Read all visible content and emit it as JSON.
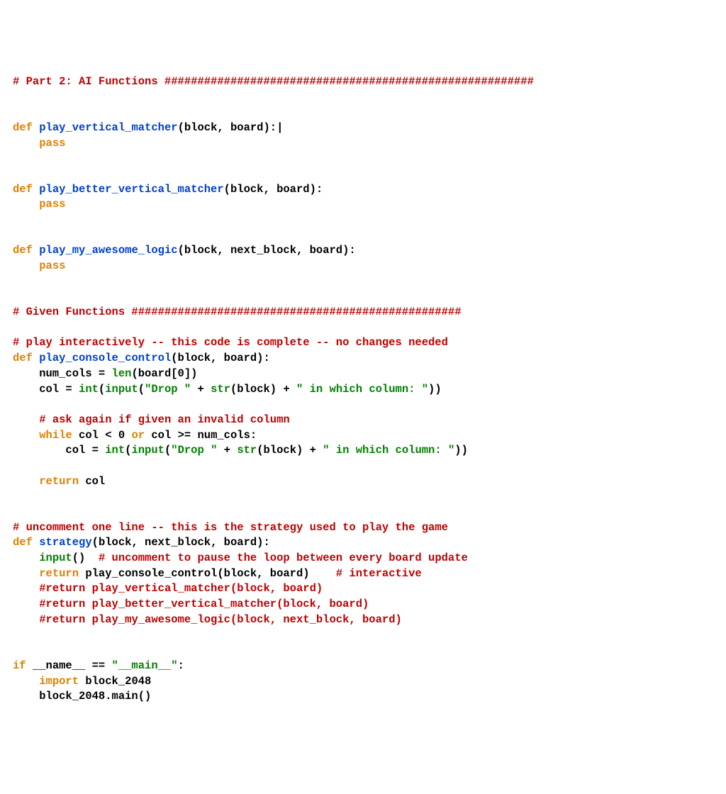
{
  "code": {
    "lines": [
      {
        "tokens": [
          {
            "cls": "t-comment",
            "t": "# Part 2: AI Functions ########################################################"
          }
        ]
      },
      {
        "tokens": []
      },
      {
        "tokens": []
      },
      {
        "tokens": [
          {
            "cls": "t-keyword",
            "t": "def"
          },
          {
            "cls": "t-default",
            "t": " "
          },
          {
            "cls": "t-funcname",
            "t": "play_vertical_matcher"
          },
          {
            "cls": "t-default",
            "t": "(block, board):"
          },
          {
            "cls": "t-cursor",
            "t": "|"
          }
        ]
      },
      {
        "tokens": [
          {
            "cls": "t-default",
            "t": "    "
          },
          {
            "cls": "t-keyword",
            "t": "pass"
          }
        ]
      },
      {
        "tokens": []
      },
      {
        "tokens": []
      },
      {
        "tokens": [
          {
            "cls": "t-keyword",
            "t": "def"
          },
          {
            "cls": "t-default",
            "t": " "
          },
          {
            "cls": "t-funcname",
            "t": "play_better_vertical_matcher"
          },
          {
            "cls": "t-default",
            "t": "(block, board):"
          }
        ]
      },
      {
        "tokens": [
          {
            "cls": "t-default",
            "t": "    "
          },
          {
            "cls": "t-keyword",
            "t": "pass"
          }
        ]
      },
      {
        "tokens": []
      },
      {
        "tokens": []
      },
      {
        "tokens": [
          {
            "cls": "t-keyword",
            "t": "def"
          },
          {
            "cls": "t-default",
            "t": " "
          },
          {
            "cls": "t-funcname",
            "t": "play_my_awesome_logic"
          },
          {
            "cls": "t-default",
            "t": "(block, next_block, board):"
          }
        ]
      },
      {
        "tokens": [
          {
            "cls": "t-default",
            "t": "    "
          },
          {
            "cls": "t-keyword",
            "t": "pass"
          }
        ]
      },
      {
        "tokens": []
      },
      {
        "tokens": []
      },
      {
        "tokens": [
          {
            "cls": "t-comment",
            "t": "# Given Functions ##################################################"
          }
        ]
      },
      {
        "tokens": []
      },
      {
        "tokens": [
          {
            "cls": "t-comment",
            "t": "# play interactively -- this code is complete -- no changes needed"
          }
        ]
      },
      {
        "tokens": [
          {
            "cls": "t-keyword",
            "t": "def"
          },
          {
            "cls": "t-default",
            "t": " "
          },
          {
            "cls": "t-funcname",
            "t": "play_console_control"
          },
          {
            "cls": "t-default",
            "t": "(block, board):"
          }
        ]
      },
      {
        "tokens": [
          {
            "cls": "t-default",
            "t": "    num_cols = "
          },
          {
            "cls": "t-builtin",
            "t": "len"
          },
          {
            "cls": "t-default",
            "t": "(board[0])"
          }
        ]
      },
      {
        "tokens": [
          {
            "cls": "t-default",
            "t": "    col = "
          },
          {
            "cls": "t-builtin",
            "t": "int"
          },
          {
            "cls": "t-default",
            "t": "("
          },
          {
            "cls": "t-builtin",
            "t": "input"
          },
          {
            "cls": "t-default",
            "t": "("
          },
          {
            "cls": "t-string",
            "t": "\"Drop \""
          },
          {
            "cls": "t-default",
            "t": " + "
          },
          {
            "cls": "t-builtin",
            "t": "str"
          },
          {
            "cls": "t-default",
            "t": "(block) + "
          },
          {
            "cls": "t-string",
            "t": "\" in which column: \""
          },
          {
            "cls": "t-default",
            "t": "))"
          }
        ]
      },
      {
        "tokens": []
      },
      {
        "tokens": [
          {
            "cls": "t-default",
            "t": "    "
          },
          {
            "cls": "t-comment",
            "t": "# ask again if given an invalid column"
          }
        ]
      },
      {
        "tokens": [
          {
            "cls": "t-default",
            "t": "    "
          },
          {
            "cls": "t-keyword",
            "t": "while"
          },
          {
            "cls": "t-default",
            "t": " col < 0 "
          },
          {
            "cls": "t-keyword",
            "t": "or"
          },
          {
            "cls": "t-default",
            "t": " col >= num_cols:"
          }
        ]
      },
      {
        "tokens": [
          {
            "cls": "t-default",
            "t": "        col = "
          },
          {
            "cls": "t-builtin",
            "t": "int"
          },
          {
            "cls": "t-default",
            "t": "("
          },
          {
            "cls": "t-builtin",
            "t": "input"
          },
          {
            "cls": "t-default",
            "t": "("
          },
          {
            "cls": "t-string",
            "t": "\"Drop \""
          },
          {
            "cls": "t-default",
            "t": " + "
          },
          {
            "cls": "t-builtin",
            "t": "str"
          },
          {
            "cls": "t-default",
            "t": "(block) + "
          },
          {
            "cls": "t-string",
            "t": "\" in which column: \""
          },
          {
            "cls": "t-default",
            "t": "))"
          }
        ]
      },
      {
        "tokens": []
      },
      {
        "tokens": [
          {
            "cls": "t-default",
            "t": "    "
          },
          {
            "cls": "t-keyword",
            "t": "return"
          },
          {
            "cls": "t-default",
            "t": " col"
          }
        ]
      },
      {
        "tokens": []
      },
      {
        "tokens": []
      },
      {
        "tokens": [
          {
            "cls": "t-comment",
            "t": "# uncomment one line -- this is the strategy used to play the game"
          }
        ]
      },
      {
        "tokens": [
          {
            "cls": "t-keyword",
            "t": "def"
          },
          {
            "cls": "t-default",
            "t": " "
          },
          {
            "cls": "t-funcname",
            "t": "strategy"
          },
          {
            "cls": "t-default",
            "t": "(block, next_block, board):"
          }
        ]
      },
      {
        "tokens": [
          {
            "cls": "t-default",
            "t": "    "
          },
          {
            "cls": "t-builtin",
            "t": "input"
          },
          {
            "cls": "t-default",
            "t": "()  "
          },
          {
            "cls": "t-comment",
            "t": "# uncomment to pause the loop between every board update"
          }
        ]
      },
      {
        "tokens": [
          {
            "cls": "t-default",
            "t": "    "
          },
          {
            "cls": "t-keyword",
            "t": "return"
          },
          {
            "cls": "t-default",
            "t": " play_console_control(block, board)    "
          },
          {
            "cls": "t-comment",
            "t": "# interactive"
          }
        ]
      },
      {
        "tokens": [
          {
            "cls": "t-default",
            "t": "    "
          },
          {
            "cls": "t-comment",
            "t": "#return play_vertical_matcher(block, board)"
          }
        ]
      },
      {
        "tokens": [
          {
            "cls": "t-default",
            "t": "    "
          },
          {
            "cls": "t-comment",
            "t": "#return play_better_vertical_matcher(block, board)"
          }
        ]
      },
      {
        "tokens": [
          {
            "cls": "t-default",
            "t": "    "
          },
          {
            "cls": "t-comment",
            "t": "#return play_my_awesome_logic(block, next_block, board)"
          }
        ]
      },
      {
        "tokens": []
      },
      {
        "tokens": []
      },
      {
        "tokens": [
          {
            "cls": "t-keyword",
            "t": "if"
          },
          {
            "cls": "t-default",
            "t": " __name__ == "
          },
          {
            "cls": "t-string",
            "t": "\"__main__\""
          },
          {
            "cls": "t-default",
            "t": ":"
          }
        ]
      },
      {
        "tokens": [
          {
            "cls": "t-default",
            "t": "    "
          },
          {
            "cls": "t-keyword",
            "t": "import"
          },
          {
            "cls": "t-default",
            "t": " block_2048"
          }
        ]
      },
      {
        "tokens": [
          {
            "cls": "t-default",
            "t": "    block_2048.main()"
          }
        ]
      }
    ]
  }
}
